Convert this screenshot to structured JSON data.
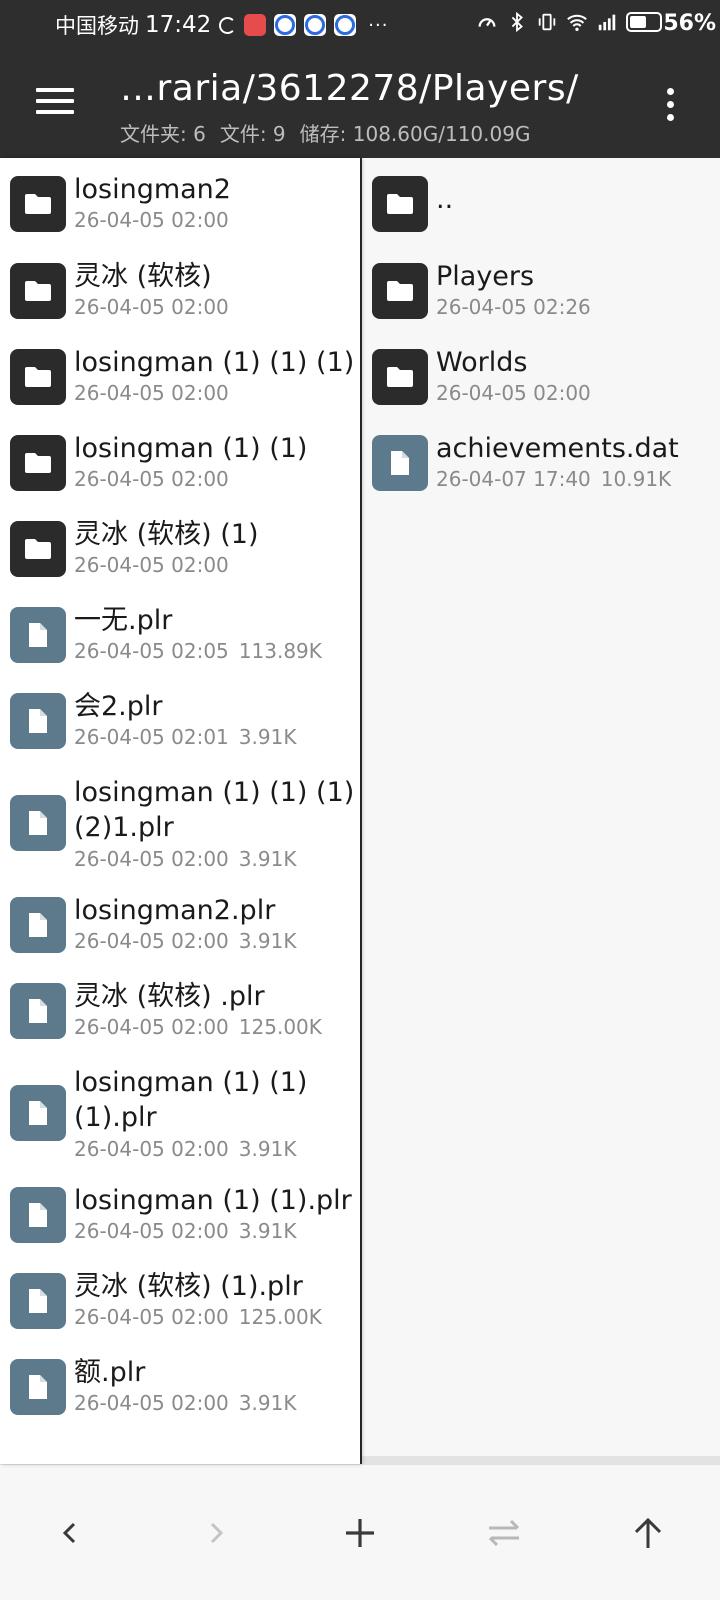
{
  "status_bar": {
    "carrier": "中国移动",
    "time": "17:42",
    "battery_percent": "56%",
    "battery_level": 0.56
  },
  "toolbar": {
    "path": "…raria/3612278/Players/",
    "folders_label": "文件夹: 6",
    "files_label": "文件: 9",
    "storage_label": "储存: 108.60G/110.09G"
  },
  "left_pane": {
    "items": [
      {
        "type": "folder",
        "name": "losingman2",
        "date": "26-04-05 02:00",
        "size": ""
      },
      {
        "type": "folder",
        "name": "灵冰 (软核)",
        "date": "26-04-05 02:00",
        "size": ""
      },
      {
        "type": "folder",
        "name": "losingman (1) (1) (1)",
        "date": "26-04-05 02:00",
        "size": ""
      },
      {
        "type": "folder",
        "name": "losingman (1) (1)",
        "date": "26-04-05 02:00",
        "size": ""
      },
      {
        "type": "folder",
        "name": "灵冰 (软核) (1)",
        "date": "26-04-05 02:00",
        "size": ""
      },
      {
        "type": "file",
        "name": "一无.plr",
        "date": "26-04-05 02:05",
        "size": "113.89K"
      },
      {
        "type": "file",
        "name": "会2.plr",
        "date": "26-04-05 02:01",
        "size": "3.91K"
      },
      {
        "type": "file",
        "name": "losingman (1) (1) (1)",
        "name2": "(2)1.plr",
        "date": "26-04-05 02:00",
        "size": "3.91K"
      },
      {
        "type": "file",
        "name": "losingman2.plr",
        "date": "26-04-05 02:00",
        "size": "3.91K"
      },
      {
        "type": "file",
        "name": "灵冰 (软核) .plr",
        "date": "26-04-05 02:00",
        "size": "125.00K"
      },
      {
        "type": "file",
        "name": "losingman (1) (1)",
        "name2": "(1).plr",
        "date": "26-04-05 02:00",
        "size": "3.91K"
      },
      {
        "type": "file",
        "name": "losingman (1) (1).plr",
        "date": "26-04-05 02:00",
        "size": "3.91K"
      },
      {
        "type": "file",
        "name": "灵冰 (软核) (1).plr",
        "date": "26-04-05 02:00",
        "size": "125.00K"
      },
      {
        "type": "file",
        "name": "额.plr",
        "date": "26-04-05 02:00",
        "size": "3.91K"
      }
    ]
  },
  "right_pane": {
    "items": [
      {
        "type": "folder",
        "name": "..",
        "date": "",
        "size": ""
      },
      {
        "type": "folder",
        "name": "Players",
        "date": "26-04-05 02:26",
        "size": ""
      },
      {
        "type": "folder",
        "name": "Worlds",
        "date": "26-04-05 02:00",
        "size": ""
      },
      {
        "type": "file",
        "name": "achievements.dat",
        "date": "26-04-07 17:40",
        "size": "10.91K"
      }
    ]
  },
  "bottom_bar": {
    "buttons": [
      "back-icon",
      "forward-icon",
      "add-icon",
      "swap-icon",
      "up-icon"
    ]
  },
  "colors": {
    "toolbar_bg": "#2e2e2e",
    "folder_icon_bg": "#2b2b2b",
    "file_icon_bg": "#5d7a8c",
    "meta_text": "#8a8a8a"
  }
}
